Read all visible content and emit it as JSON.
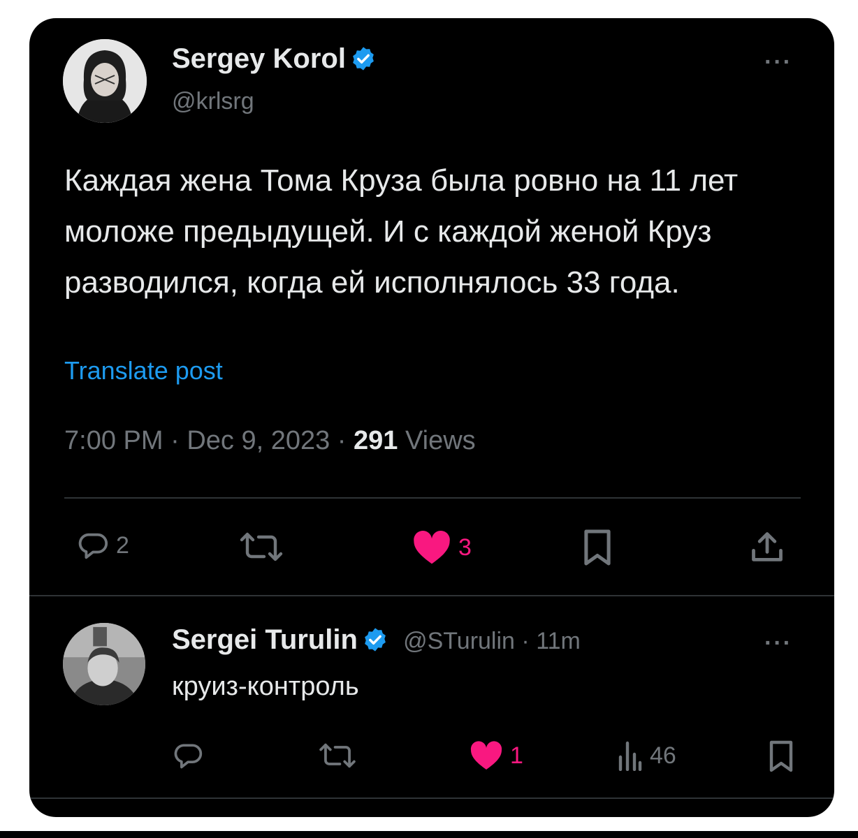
{
  "post": {
    "author_name": "Sergey Korol",
    "handle": "@krlsrg",
    "text": "Каждая жена Тома Круза была ровно на 11 лет моложе предыдущей. И с каждой женой Круз разводился, когда ей исполнялось 33 года.",
    "translate_label": "Translate post",
    "time": "7:00 PM",
    "date": "Dec 9, 2023",
    "views_count": "291",
    "views_label": "Views",
    "separator": "·",
    "more_label": "···",
    "actions": {
      "replies": "2",
      "likes": "3"
    }
  },
  "reply": {
    "author_name": "Sergei Turulin",
    "handle": "@STurulin",
    "separator": "·",
    "time": "11m",
    "text": "круиз-контроль",
    "more_label": "···",
    "actions": {
      "likes": "1",
      "views": "46"
    }
  },
  "colors": {
    "background": "#000000",
    "text": "#e7e9ea",
    "muted": "#71767b",
    "link": "#1d9bf0",
    "like": "#f91880",
    "verified": "#1d9bf0"
  },
  "icons": [
    "verified-badge-icon",
    "more-icon",
    "reply-icon",
    "retweet-icon",
    "heart-icon",
    "bookmark-icon",
    "share-icon",
    "views-icon"
  ]
}
